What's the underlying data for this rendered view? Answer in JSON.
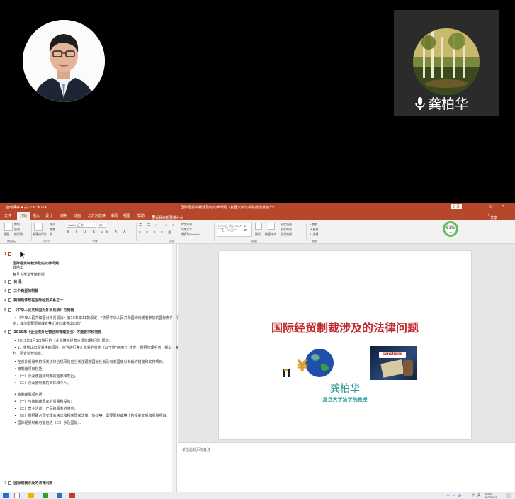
{
  "meeting": {
    "remote_participant": {
      "name": "龚柏华"
    }
  },
  "window": {
    "title": "国际经贸制裁涉及的法律问题（复旦大学法学院教授龚柏华）",
    "login_label": "登录",
    "window_controls": "— ◻ ✕"
  },
  "ribbon_tabs": [
    "文件",
    "开始",
    "插入",
    "设计",
    "切换",
    "动画",
    "幻灯片放映",
    "审阅",
    "视图",
    "帮助"
  ],
  "tell_me": "告诉我你想要做什么",
  "share_label": "共享",
  "ribbon": {
    "groups": [
      "剪贴板",
      "幻灯片",
      "字体",
      "段落",
      "绘图",
      "编辑"
    ],
    "font_name": "Calibri (正文)",
    "font_size": "28",
    "paste_label": "粘贴",
    "new_slide_label": "新建幻灯片",
    "arrange_label": "排列",
    "quick_styles_label": "快速样式",
    "find_label": "查找",
    "replace_label": "替换",
    "select_label": "选择",
    "cut_label": "剪切",
    "copy_label": "复制",
    "format_painter_label": "格式刷",
    "layout_label": "版式",
    "reset_label": "重置",
    "section_label": "节",
    "text_direction_label": "文字方向",
    "align_text_label": "对齐文本",
    "smartart_label": "转换为SmartArt",
    "shape_fill_label": "形状填充",
    "shape_outline_label": "形状轮廓",
    "shape_effects_label": "形状效果"
  },
  "network_ring": {
    "percent": "61%",
    "speed": "1.1K/s"
  },
  "outline": {
    "items": [
      {
        "num": "1",
        "text": "国际经贸制裁涉及的法律问题"
      },
      {
        "num": "",
        "text": "龚柏华"
      },
      {
        "num": "",
        "text": "复旦大学法学院教授"
      },
      {
        "num": "2",
        "text": "目 录"
      },
      {
        "num": "3",
        "text": "三个典型的制裁"
      },
      {
        "num": "4",
        "text": "制裁是体现在国际经贸关系之一"
      },
      {
        "num": "5",
        "text": "《中华人民共和国对外贸易法》与制裁"
      },
      {
        "num": "",
        "text": "•  《中华人民共和国对外贸易法》第16条第11款规定：\"依照中华人民共和国缔结或者参加的国际条约、协定的规"
      },
      {
        "num": "",
        "text": "定，其他需要限制或者禁止进口或者出口的\""
      },
      {
        "num": "6",
        "text": "2019年《企业境外经营合规管理指引》方面要求和措施"
      },
      {
        "num": "",
        "text": "•  2019年3月1日施行的《企业境外经营合规管理指引》规定："
      },
      {
        "num": "",
        "text": "•  1、货物出口贸易中的风险，应当进行禁止交易的货物（以下称\"两用\"）核查，根据管理手册，提出有关资"
      },
      {
        "num": "",
        "text": "料、配合监管检查。"
      },
      {
        "num": "",
        "text": "•  在对外贸易中的相关法律合规风险应当关注跟踪国际社会及有关国家对制裁的措施和安排项目。"
      },
      {
        "num": "",
        "text": "•  被制裁项目包括："
      },
      {
        "num": "",
        "text": "•  （一）涉及被国际制裁的国家和地区；"
      },
      {
        "num": "",
        "text": "•  （二）涉及被制裁的实体和个人。"
      },
      {
        "num": "",
        "text": "•  被制裁事项包括："
      },
      {
        "num": "",
        "text": "•  （一）与被制裁国家的贸易和投资；"
      },
      {
        "num": "",
        "text": "•  （二）营业活动、产品和服务的供应；"
      },
      {
        "num": "",
        "text": "•  （三）根据联合国安理会决议和相关国家法律，协议等，需要限制或禁止的相关交易和贸易项目。"
      },
      {
        "num": "",
        "text": "•  国际经贸制裁可能包括（二）涉及国际..."
      },
      {
        "num": "7",
        "text": "国际制裁涉及的法律问题"
      }
    ]
  },
  "slide": {
    "title": "国际经贸制裁涉及的法律问题",
    "name": "龚柏华",
    "affiliation": "复旦大学法学院教授",
    "sanctions_label": "sanctions",
    "currency_symbol": "¥"
  },
  "notes_placeholder": "单击此处添加备注",
  "status": {
    "slide_info": "幻灯片 第 1 张，共 145 张",
    "language": "中文(中国)",
    "notes_btn": "备注",
    "comments_btn": "批注",
    "zoom": "76%"
  },
  "taskbar": {
    "time": "15:03",
    "date": "2022/4/11",
    "ime": "中",
    "lang": "英"
  },
  "colors": {
    "ppt_accent": "#b7472a",
    "slide_title": "#c0282d",
    "slide_author": "#2e9a9a",
    "network_ring": "#5cc05c"
  }
}
